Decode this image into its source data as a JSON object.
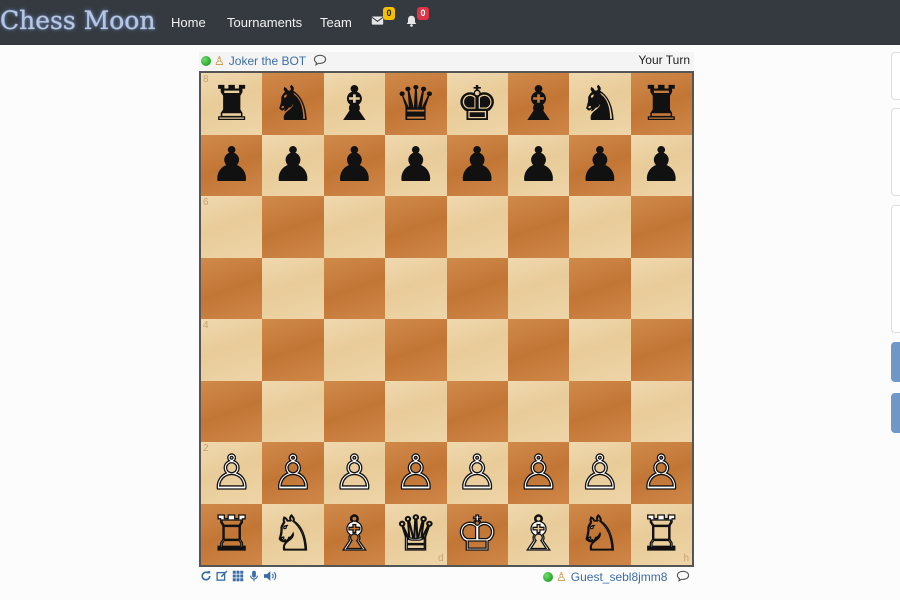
{
  "nav": {
    "brand": "Chess Moon",
    "links": [
      "Home",
      "Tournaments",
      "Team"
    ],
    "messages_count": "0",
    "notifications_count": "0"
  },
  "top_player": {
    "name": "Joker the BOT",
    "status": "online",
    "turn_text": "Your Turn"
  },
  "bottom_player": {
    "name": "Guest_sebl8jmm8",
    "status": "online"
  },
  "board": {
    "ranks": [
      [
        "♜",
        "♞",
        "♝",
        "♛",
        "♚",
        "♝",
        "♞",
        "♜"
      ],
      [
        "♟",
        "♟",
        "♟",
        "♟",
        "♟",
        "♟",
        "♟",
        "♟"
      ],
      [
        "",
        "",
        "",
        "",
        "",
        "",
        "",
        ""
      ],
      [
        "",
        "",
        "",
        "",
        "",
        "",
        "",
        ""
      ],
      [
        "",
        "",
        "",
        "",
        "",
        "",
        "",
        ""
      ],
      [
        "",
        "",
        "",
        "",
        "",
        "",
        "",
        ""
      ],
      [
        "♙",
        "♙",
        "♙",
        "♙",
        "♙",
        "♙",
        "♙",
        "♙"
      ],
      [
        "♖",
        "♘",
        "♗",
        "♕",
        "♔",
        "♗",
        "♘",
        "♖"
      ]
    ],
    "rank_labels": [
      "8",
      "6",
      "4",
      "2"
    ],
    "file_labels": [
      "d",
      "h"
    ]
  },
  "tool_icons": [
    "refresh-icon",
    "edit-icon",
    "grid-icon",
    "microphone-icon",
    "volume-icon"
  ],
  "colors": {
    "navbar": "#343a40",
    "link": "#3c6da6",
    "badge_yellow": "#f5c000",
    "badge_red": "#dc3545"
  }
}
